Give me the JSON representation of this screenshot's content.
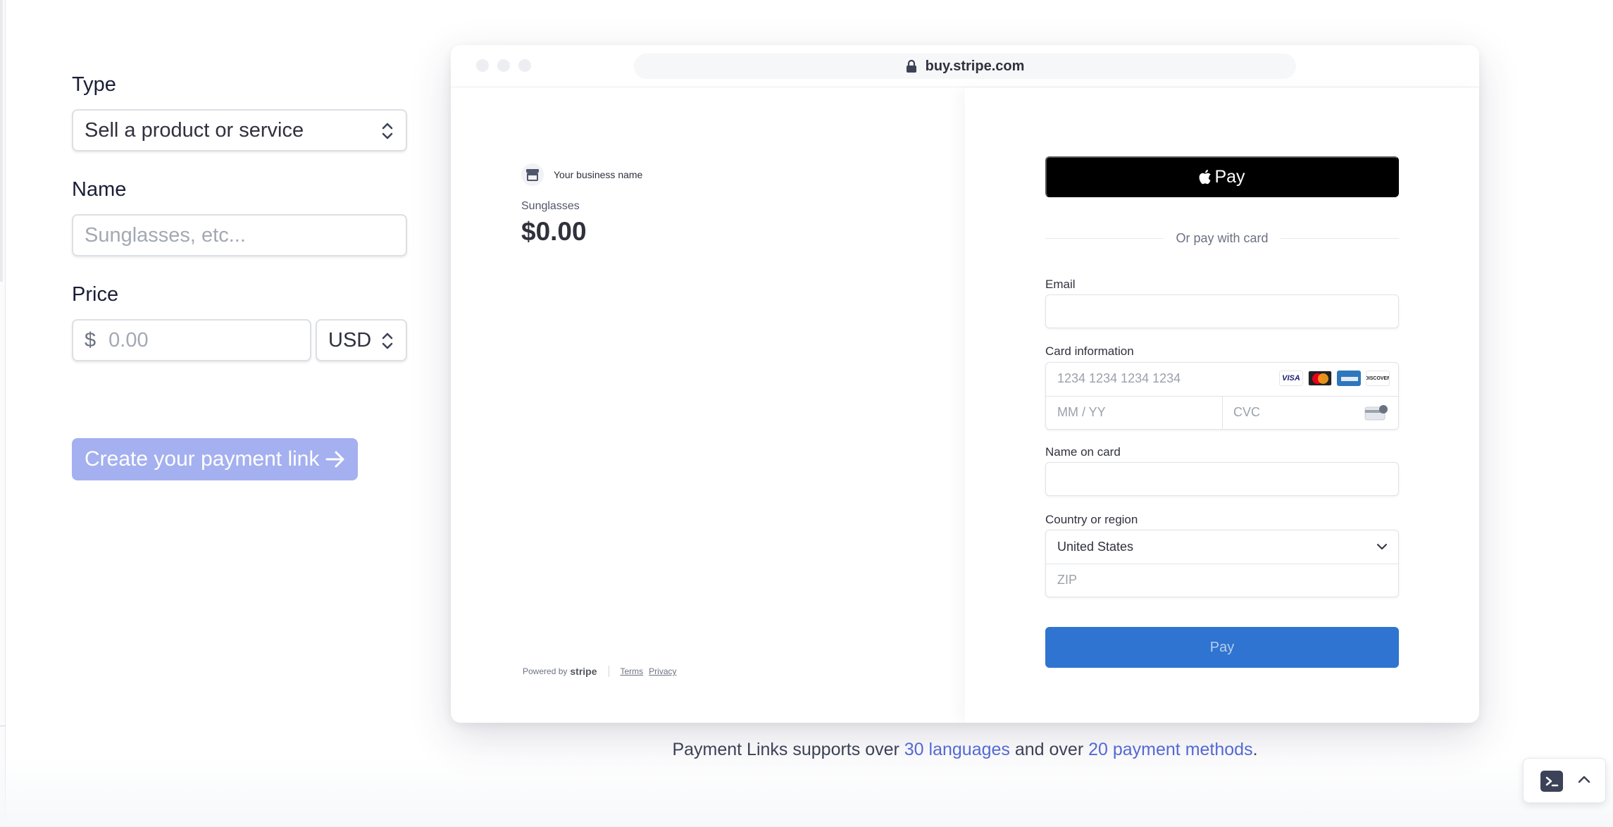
{
  "form": {
    "type_label": "Type",
    "type_value": "Sell a product or service",
    "name_label": "Name",
    "name_placeholder": "Sunglasses, etc...",
    "price_label": "Price",
    "currency_symbol": "$",
    "price_placeholder": "0.00",
    "currency_value": "USD",
    "create_button": "Create your payment link"
  },
  "browser": {
    "url": "buy.stripe.com"
  },
  "checkout": {
    "business_name": "Your business name",
    "product_name": "Sunglasses",
    "product_price": "$0.00",
    "apple_pay_label": "Pay",
    "divider_text": "Or pay with card",
    "email_label": "Email",
    "card_info_label": "Card information",
    "card_number_placeholder": "1234 1234 1234 1234",
    "expiry_placeholder": "MM / YY",
    "cvc_placeholder": "CVC",
    "card_brands": [
      "VISA",
      "mastercard",
      "amex",
      "DISCOVER"
    ],
    "name_on_card_label": "Name on card",
    "country_label": "Country or region",
    "country_value": "United States",
    "zip_placeholder": "ZIP",
    "pay_button": "Pay",
    "footer": {
      "powered_by": "Powered by",
      "stripe": "stripe",
      "terms": "Terms",
      "privacy": "Privacy"
    }
  },
  "caption": {
    "prefix": "Payment Links supports over ",
    "languages_link": "30 languages",
    "middle": " and over ",
    "methods_link": "20 payment methods",
    "suffix": "."
  },
  "colors": {
    "accent": "#5469d4",
    "create_button_bg": "#a4b0ef",
    "pay_button_bg": "#2f74d0",
    "apple_pay_bg": "#000000"
  },
  "icons": [
    "updown-chevron-icon",
    "arrow-right-icon",
    "lock-icon",
    "store-icon",
    "apple-icon",
    "chevron-down-icon",
    "cvc-card-icon",
    "terminal-icon",
    "chevron-up-icon"
  ]
}
